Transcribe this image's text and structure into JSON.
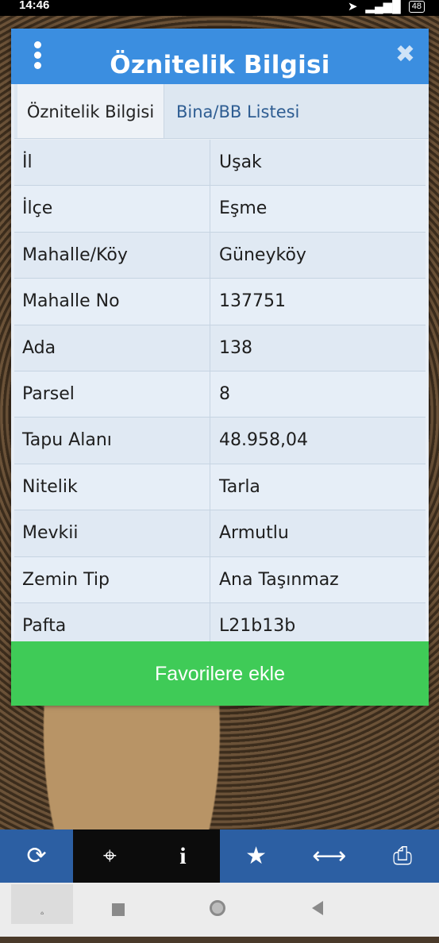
{
  "status": {
    "time": "14:46",
    "battery": "48"
  },
  "dialog": {
    "title": "Öznitelik Bilgisi",
    "tabs": [
      "Öznitelik Bilgisi",
      "Bina/BB Listesi"
    ],
    "rows": [
      {
        "label": "İl",
        "value": "Uşak"
      },
      {
        "label": "İlçe",
        "value": "Eşme"
      },
      {
        "label": "Mahalle/Köy",
        "value": "Güneyköy"
      },
      {
        "label": "Mahalle No",
        "value": "137751"
      },
      {
        "label": "Ada",
        "value": "138"
      },
      {
        "label": "Parsel",
        "value": "8"
      },
      {
        "label": "Tapu Alanı",
        "value": "48.958,04"
      },
      {
        "label": "Nitelik",
        "value": "Tarla"
      },
      {
        "label": "Mevkii",
        "value": "Armutlu"
      },
      {
        "label": "Zemin Tip",
        "value": "Ana Taşınmaz"
      },
      {
        "label": "Pafta",
        "value": "L21b13b"
      }
    ],
    "favorite_button": "Favorilere ekle"
  },
  "toolbar_icons": [
    "refresh-icon",
    "locate-icon",
    "info-icon",
    "star-icon",
    "measure-icon",
    "print-icon"
  ],
  "colors": {
    "header": "#3b8ee0",
    "button": "#3fcb57",
    "toolbar": "#2c5fa3"
  }
}
